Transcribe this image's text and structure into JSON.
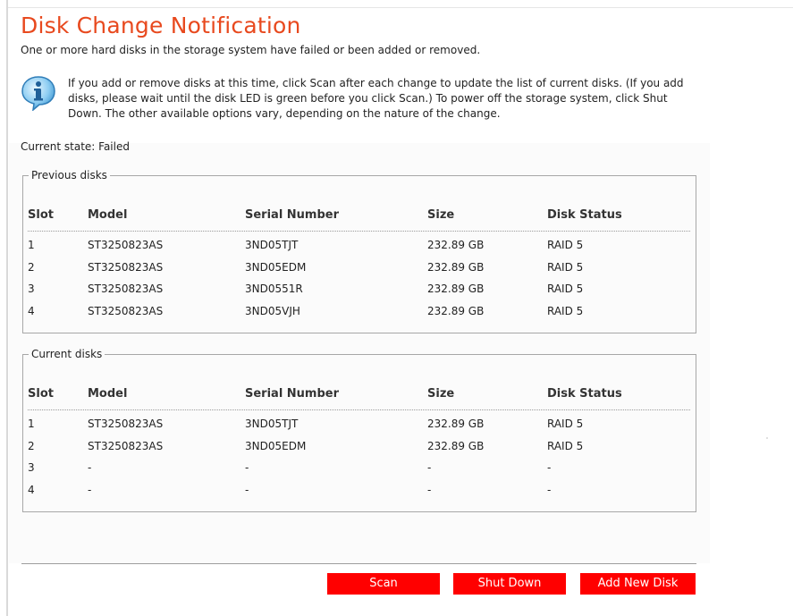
{
  "page": {
    "title": "Disk Change Notification",
    "subtitle": "One or more hard disks in the storage system have failed or been added or removed.",
    "info": "If you add or remove disks at this time, click Scan after each change to update the list of current disks. (If you add disks, please wait until the disk LED is green before you click Scan.) To power off the storage system, click Shut Down. The other available options vary, depending on the nature of the change.",
    "info_icon": "info-bubble-icon",
    "current_state_label": "Current state:",
    "current_state_value": "Failed"
  },
  "columns": [
    "Slot",
    "Model",
    "Serial Number",
    "Size",
    "Disk Status"
  ],
  "previous_disks": {
    "legend": "Previous disks",
    "rows": [
      {
        "slot": "1",
        "model": "ST3250823AS",
        "serial": "3ND05TJT",
        "size": "232.89 GB",
        "status": "RAID 5"
      },
      {
        "slot": "2",
        "model": "ST3250823AS",
        "serial": "3ND05EDM",
        "size": "232.89 GB",
        "status": "RAID 5"
      },
      {
        "slot": "3",
        "model": "ST3250823AS",
        "serial": "3ND0551R",
        "size": "232.89 GB",
        "status": "RAID 5"
      },
      {
        "slot": "4",
        "model": "ST3250823AS",
        "serial": "3ND05VJH",
        "size": "232.89 GB",
        "status": "RAID 5"
      }
    ]
  },
  "current_disks": {
    "legend": "Current disks",
    "rows": [
      {
        "slot": "1",
        "model": "ST3250823AS",
        "serial": "3ND05TJT",
        "size": "232.89 GB",
        "status": "RAID 5"
      },
      {
        "slot": "2",
        "model": "ST3250823AS",
        "serial": "3ND05EDM",
        "size": "232.89 GB",
        "status": "RAID 5"
      },
      {
        "slot": "3",
        "model": "-",
        "serial": "-",
        "size": "-",
        "status": "-"
      },
      {
        "slot": "4",
        "model": "-",
        "serial": "-",
        "size": "-",
        "status": "-"
      }
    ]
  },
  "buttons": {
    "scan": "Scan",
    "shut_down": "Shut Down",
    "add_new_disk": "Add New Disk"
  },
  "colors": {
    "title": "#e8491e",
    "button_bg": "#ff0000",
    "button_text": "#ffffff"
  }
}
